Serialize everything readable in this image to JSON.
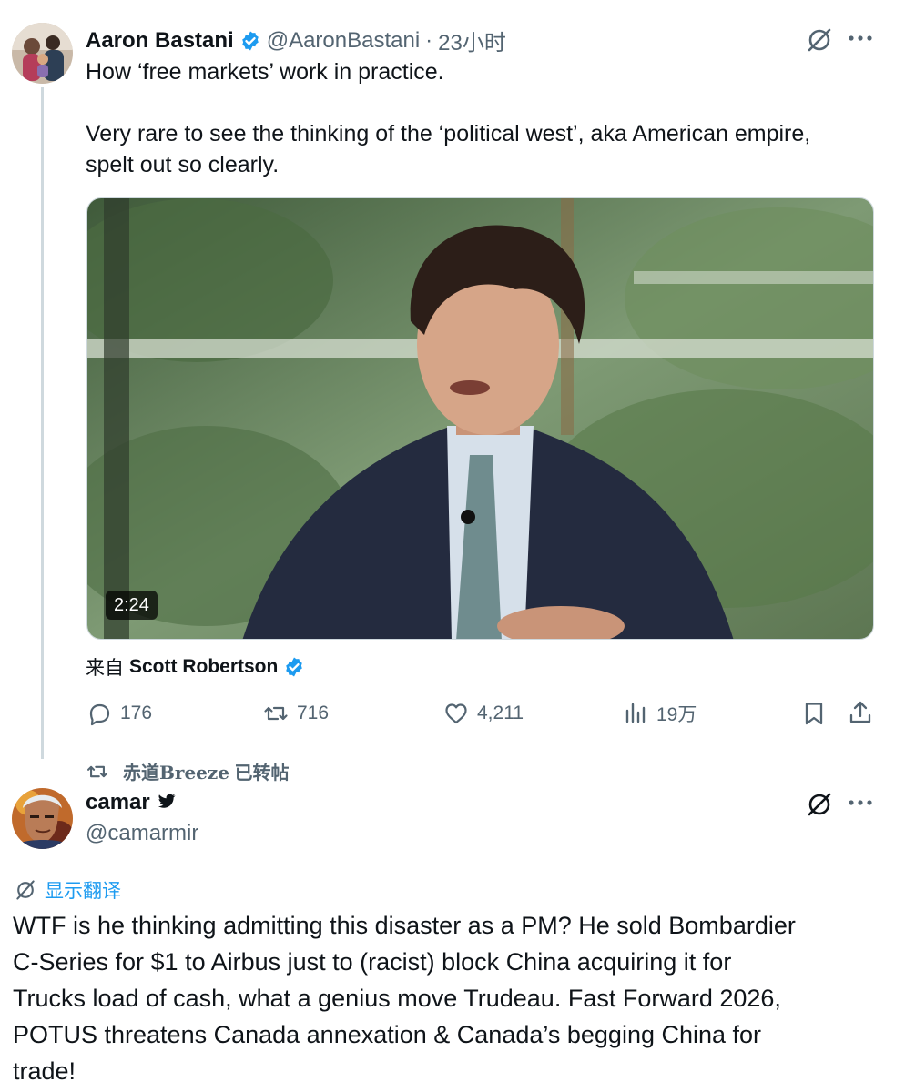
{
  "tweet1": {
    "author_name": "Aaron Bastani",
    "handle": "@AaronBastani",
    "separator": "·",
    "time": "23小时",
    "text_line1": "How ‘free markets’ work in practice.",
    "text_line2": "Very rare to see the thinking of the ‘political west’, aka American empire,",
    "text_line3": "spelt out so clearly.",
    "video_duration": "2:24",
    "source_prefix": "来自",
    "source_name": "Scott Robertson",
    "replies": "176",
    "retweets": "716",
    "likes": "4,211",
    "views": "19万"
  },
  "retweet_notice": {
    "user": "赤道Breeze",
    "suffix": "已转帖"
  },
  "tweet2": {
    "author_name": "camar",
    "handle": "@camarmir",
    "translate_label": "显示翻译",
    "text_lines": [
      "WTF is he thinking admitting this disaster as a PM? He sold Bombardier",
      "C-Series for $1 to Airbus just to (racist) block China acquiring it for",
      "Trucks load of cash, what a genius move Trudeau. Fast Forward 2026,",
      "POTUS threatens Canada annexation & Canada’s begging China for",
      "trade!"
    ]
  },
  "colors": {
    "text_primary": "#0f1419",
    "text_secondary": "#536471",
    "verified_blue": "#1d9bf0",
    "link_blue": "#1d9bf0",
    "thread_line": "#cfd9de"
  },
  "icons": {
    "grok": "grok-icon",
    "more": "more-icon",
    "reply": "reply-icon",
    "retweet": "retweet-icon",
    "like": "like-icon",
    "views": "views-icon",
    "bookmark": "bookmark-icon",
    "share": "share-icon",
    "verified": "verified-badge-icon",
    "bird": "twitter-bird-icon",
    "translate": "translate-icon"
  }
}
